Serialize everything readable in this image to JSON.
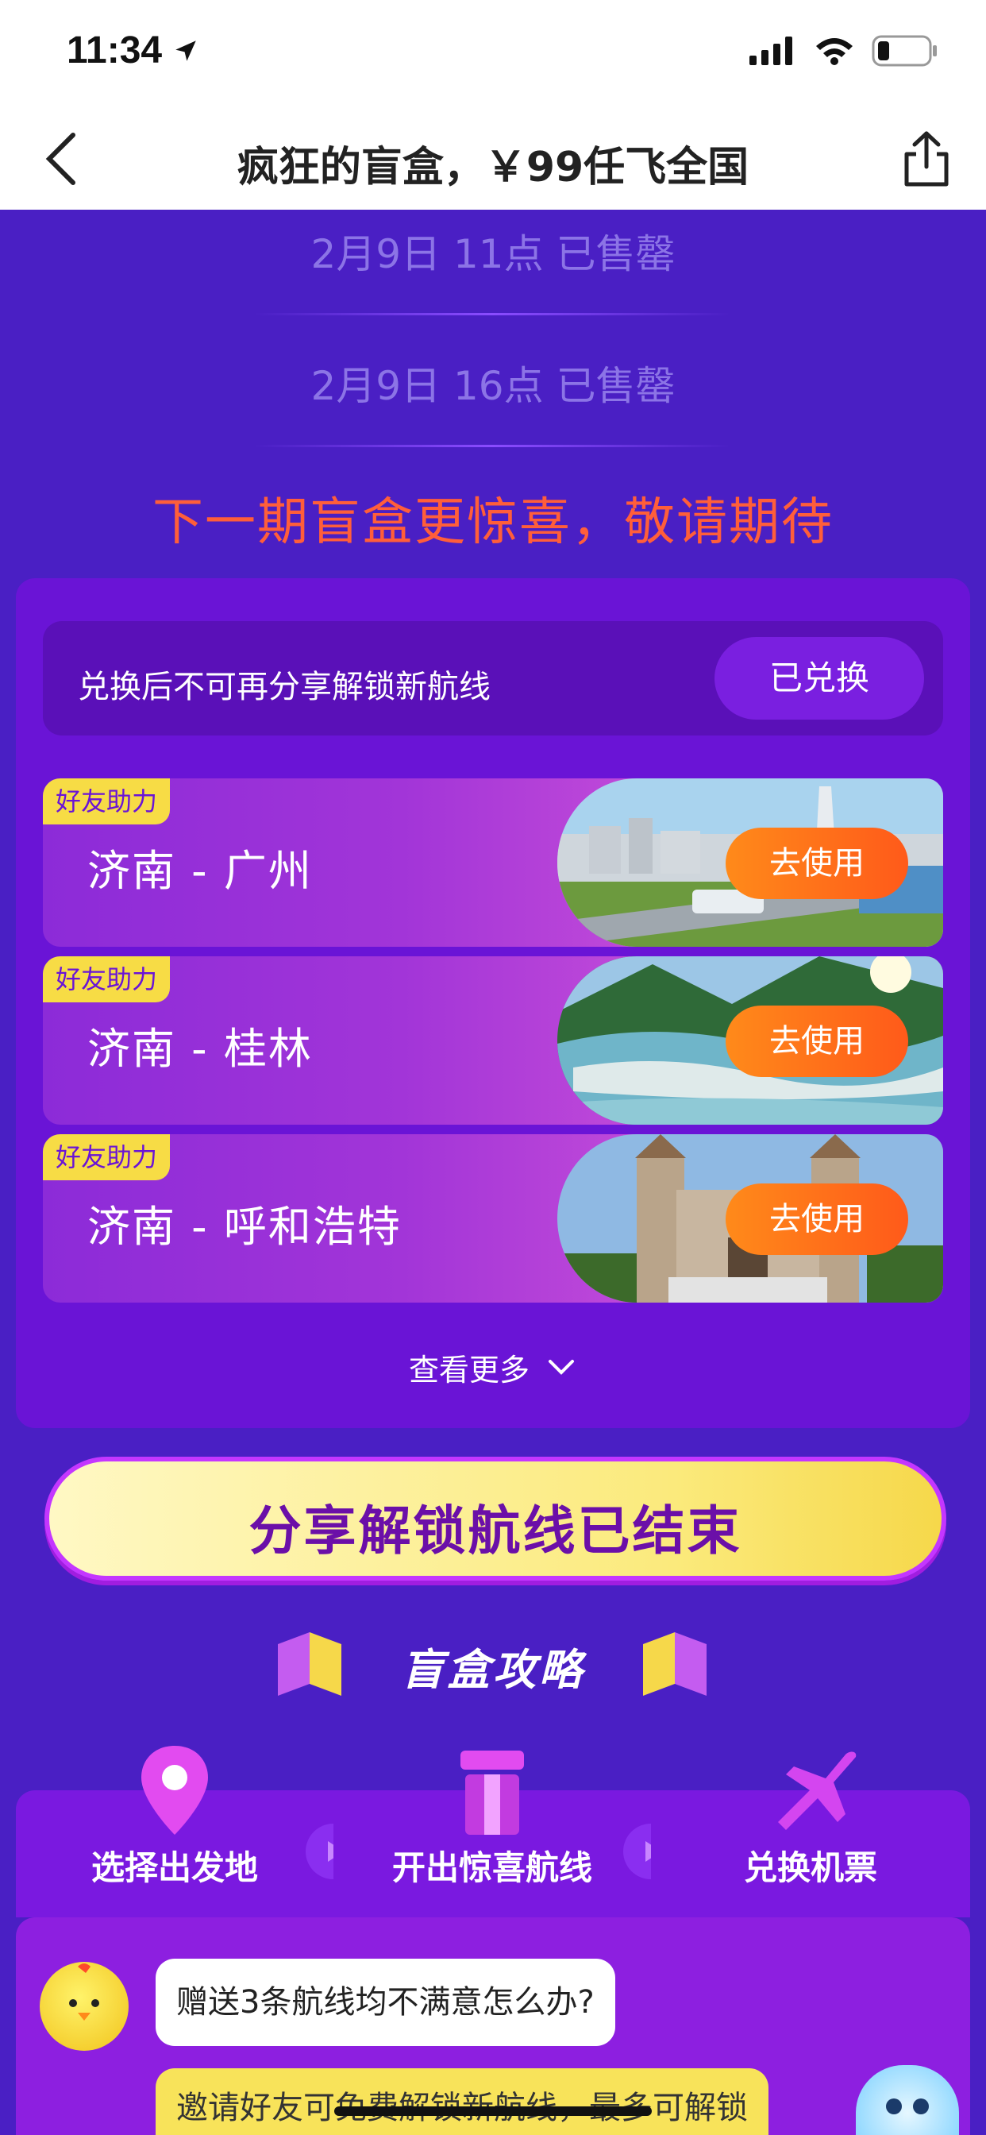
{
  "status": {
    "time": "11:34"
  },
  "nav": {
    "title": "疯狂的盲盒，￥99任飞全国"
  },
  "sold_out": [
    {
      "label": "2月9日 11点 已售罄"
    },
    {
      "label": "2月9日 16点 已售罄"
    }
  ],
  "next_notice": "下一期盲盒更惊喜，敬请期待",
  "redeem": {
    "text": "兑换后不可再分享解锁新航线",
    "button": "已兑换"
  },
  "routes": [
    {
      "tag": "好友助力",
      "name": "济南 - 广州",
      "button": "去使用"
    },
    {
      "tag": "好友助力",
      "name": "济南 - 桂林",
      "button": "去使用"
    },
    {
      "tag": "好友助力",
      "name": "济南 - 呼和浩特",
      "button": "去使用"
    }
  ],
  "see_more": "查看更多",
  "share_ended": "分享解锁航线已结束",
  "strategy": {
    "title": "盲盒攻略"
  },
  "steps": [
    {
      "label": "选择出发地",
      "icon": "location-pin-icon"
    },
    {
      "label": "开出惊喜航线",
      "icon": "blind-box-icon"
    },
    {
      "label": "兑换机票",
      "icon": "airplane-icon"
    }
  ],
  "faq": {
    "question": "赠送3条航线均不满意怎么办?",
    "answer": "邀请好友可免费解锁新航线，最多可解锁"
  },
  "colors": {
    "accent": "#6a14d6",
    "notice": "#ff5e3a",
    "button": "#ff6a1a",
    "tag": "#f7dc45"
  }
}
